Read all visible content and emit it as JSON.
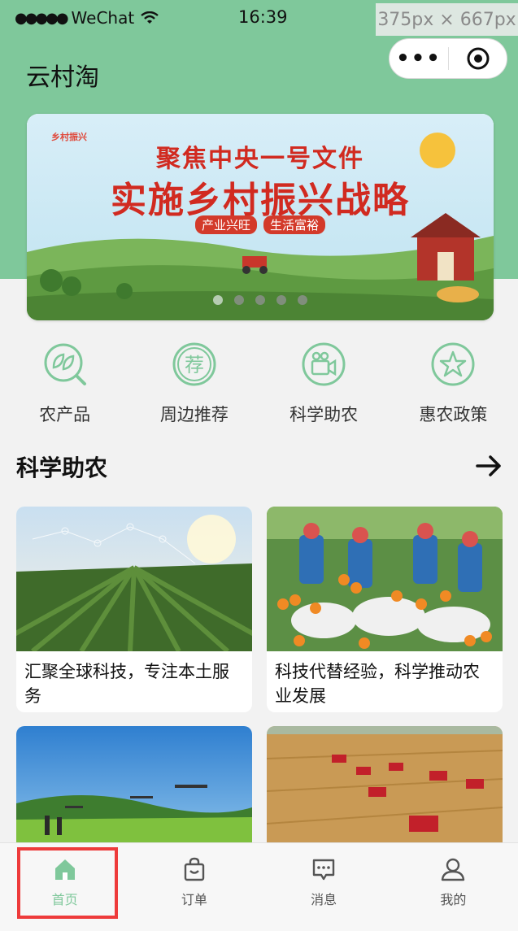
{
  "status_bar": {
    "carrier": "WeChat",
    "time": "16:39",
    "dimension_overlay": "375px × 667px"
  },
  "header": {
    "title": "云村淘",
    "bg_color": "#7fc89b"
  },
  "banner": {
    "logo": "乡村振兴",
    "headline_1": "聚焦中央一号文件",
    "headline_2": "实施乡村振兴战略",
    "tags": [
      "产业兴旺",
      "生活富裕"
    ],
    "dots": 5,
    "active_dot": 0
  },
  "quick_nav": [
    {
      "label": "农产品",
      "icon": "leaf-search-icon"
    },
    {
      "label": "周边推荐",
      "icon": "recommend-icon"
    },
    {
      "label": "科学助农",
      "icon": "video-camera-icon"
    },
    {
      "label": "惠农政策",
      "icon": "star-icon"
    }
  ],
  "section": {
    "title": "科学助农",
    "more_icon": "arrow-right-icon"
  },
  "cards": [
    {
      "caption": "汇聚全球科技，专注本土服务"
    },
    {
      "caption": "科技代替经验，科学推动农业发展"
    },
    {
      "caption": ""
    },
    {
      "caption": ""
    }
  ],
  "tabbar": {
    "items": [
      {
        "label": "首页",
        "icon": "home-icon",
        "active": true
      },
      {
        "label": "订单",
        "icon": "shopping-bag-icon",
        "active": false
      },
      {
        "label": "消息",
        "icon": "message-icon",
        "active": false
      },
      {
        "label": "我的",
        "icon": "user-icon",
        "active": false
      }
    ],
    "accent": "#7fc89b",
    "highlight_color": "#ee3b3b"
  }
}
